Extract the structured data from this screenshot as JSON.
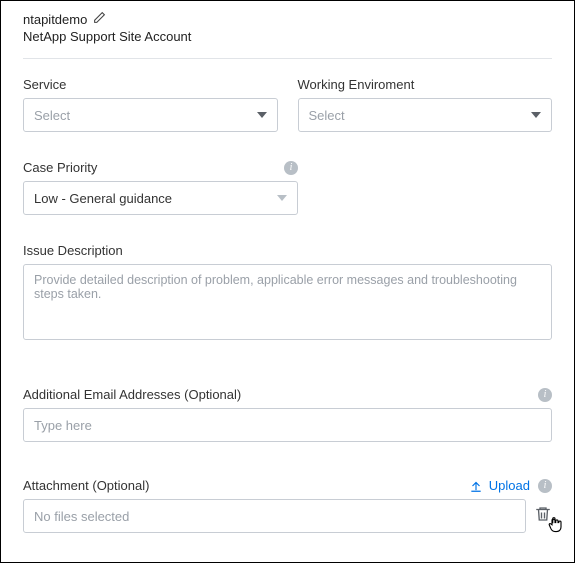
{
  "account": {
    "name": "ntapitdemo",
    "type": "NetApp Support Site Account"
  },
  "service": {
    "label": "Service",
    "placeholder": "Select"
  },
  "environment": {
    "label": "Working Enviroment",
    "placeholder": "Select"
  },
  "priority": {
    "label": "Case Priority",
    "value": "Low - General guidance"
  },
  "issue": {
    "label": "Issue Description",
    "placeholder": "Provide detailed description of problem, applicable error messages and troubleshooting steps taken."
  },
  "emails": {
    "label": "Additional Email Addresses (Optional)",
    "placeholder": "Type here"
  },
  "attachment": {
    "label": "Attachment (Optional)",
    "upload_label": "Upload",
    "placeholder": "No files selected"
  }
}
